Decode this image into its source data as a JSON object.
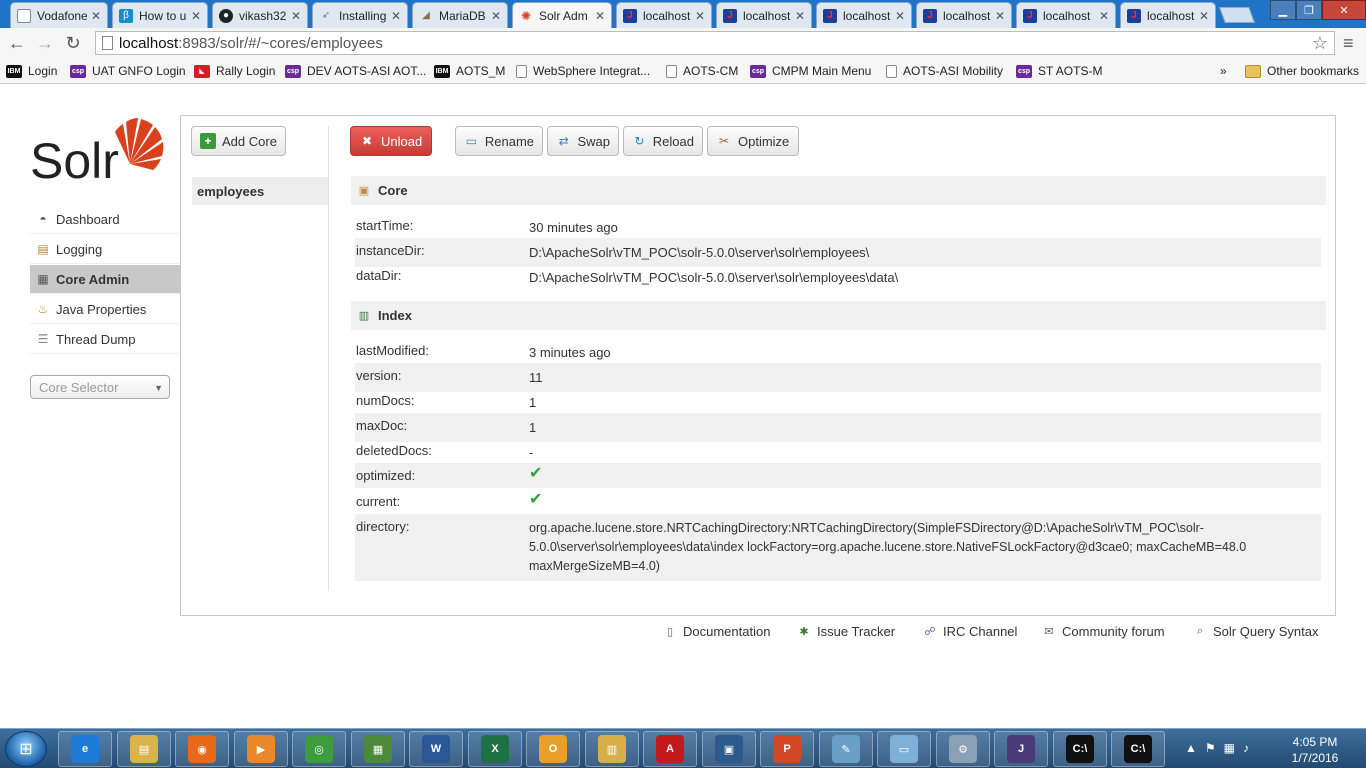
{
  "browser": {
    "tabs": [
      {
        "title": "Vodafone",
        "icon": "page-icon",
        "active": false
      },
      {
        "title": "How to u",
        "icon": "b-icon",
        "active": false
      },
      {
        "title": "vikash32",
        "icon": "github-icon",
        "active": false
      },
      {
        "title": "Installing",
        "icon": "feather-icon",
        "active": false
      },
      {
        "title": "MariaDB",
        "icon": "seal-icon",
        "active": false
      },
      {
        "title": "Solr Adm",
        "icon": "solr-icon",
        "active": true
      },
      {
        "title": "localhost",
        "icon": "j-icon",
        "active": false
      },
      {
        "title": "localhost",
        "icon": "j-icon",
        "active": false
      },
      {
        "title": "localhost",
        "icon": "j-icon",
        "active": false
      },
      {
        "title": "localhost",
        "icon": "j-icon",
        "active": false
      },
      {
        "title": "localhost",
        "icon": "j-icon",
        "active": false
      },
      {
        "title": "localhost",
        "icon": "j-icon",
        "active": false
      }
    ],
    "url_host": "localhost",
    "url_rest": ":8983/solr/#/~cores/employees",
    "bookmarks": [
      {
        "label": "Login",
        "icon": "ibm-icon"
      },
      {
        "label": "UAT GNFO Login",
        "icon": "csp-icon"
      },
      {
        "label": "Rally Login",
        "icon": "rally-icon"
      },
      {
        "label": "DEV AOTS-ASI AOT...",
        "icon": "csp-icon"
      },
      {
        "label": "AOTS_M",
        "icon": "ibm-icon"
      },
      {
        "label": "WebSphere Integrat...",
        "icon": "page-icon"
      },
      {
        "label": "AOTS-CM",
        "icon": "page-icon"
      },
      {
        "label": "CMPM Main Menu",
        "icon": "csp-icon"
      },
      {
        "label": "AOTS-ASI Mobility",
        "icon": "page-icon"
      },
      {
        "label": "ST AOTS-M",
        "icon": "csp-icon"
      }
    ],
    "bookmarks_overflow": "»",
    "other_bookmarks": "Other bookmarks",
    "ibm_text": "IBM",
    "csp_text": "csp"
  },
  "solr": {
    "logo_text": "Solr",
    "nav": [
      {
        "label": "Dashboard",
        "icon": "dashboard-icon"
      },
      {
        "label": "Logging",
        "icon": "logging-icon"
      },
      {
        "label": "Core Admin",
        "icon": "core-admin-icon",
        "active": true
      },
      {
        "label": "Java Properties",
        "icon": "java-properties-icon"
      },
      {
        "label": "Thread Dump",
        "icon": "thread-dump-icon"
      }
    ],
    "core_selector_placeholder": "Core Selector",
    "add_core_label": "Add Core",
    "core_list": [
      "employees"
    ],
    "actions": {
      "unload": "Unload",
      "rename": "Rename",
      "swap": "Swap",
      "reload": "Reload",
      "optimize": "Optimize"
    },
    "core_section": {
      "title": "Core",
      "rows": [
        {
          "key": "startTime:",
          "value": "30 minutes ago"
        },
        {
          "key": "instanceDir:",
          "value": "D:\\ApacheSolr\\vTM_POC\\solr-5.0.0\\server\\solr\\employees\\"
        },
        {
          "key": "dataDir:",
          "value": "D:\\ApacheSolr\\vTM_POC\\solr-5.0.0\\server\\solr\\employees\\data\\"
        }
      ]
    },
    "index_section": {
      "title": "Index",
      "rows": [
        {
          "key": "lastModified:",
          "value": "3 minutes ago"
        },
        {
          "key": "version:",
          "value": "11"
        },
        {
          "key": "numDocs:",
          "value": "1"
        },
        {
          "key": "maxDoc:",
          "value": "1"
        },
        {
          "key": "deletedDocs:",
          "value": "-"
        },
        {
          "key": "optimized:",
          "value": "✔"
        },
        {
          "key": "current:",
          "value": "✔"
        },
        {
          "key": "directory:",
          "value": "org.apache.lucene.store.NRTCachingDirectory:NRTCachingDirectory(SimpleFSDirectory@D:\\ApacheSolr\\vTM_POC\\solr-5.0.0\\server\\solr\\employees\\data\\index lockFactory=org.apache.lucene.store.NativeFSLockFactory@d3cae0; maxCacheMB=48.0 maxMergeSizeMB=4.0)"
        }
      ]
    },
    "footer": [
      {
        "label": "Documentation",
        "icon": "documentation-icon"
      },
      {
        "label": "Issue Tracker",
        "icon": "bug-icon"
      },
      {
        "label": "IRC Channel",
        "icon": "irc-icon"
      },
      {
        "label": "Community forum",
        "icon": "mail-icon"
      },
      {
        "label": "Solr Query Syntax",
        "icon": "query-syntax-icon"
      }
    ]
  },
  "taskbar": {
    "time": "4:05 PM",
    "date": "1/7/2016",
    "apps": [
      {
        "name": "internet-explorer-icon",
        "color": "#1e7ad6",
        "glyph": "e"
      },
      {
        "name": "file-explorer-icon",
        "color": "#d9b44a",
        "glyph": "▤"
      },
      {
        "name": "firefox-icon",
        "color": "#e66a1a",
        "glyph": "◉"
      },
      {
        "name": "media-player-icon",
        "color": "#e8892a",
        "glyph": "▶"
      },
      {
        "name": "chrome-icon",
        "color": "#3e9b3e",
        "glyph": "◎"
      },
      {
        "name": "project-icon",
        "color": "#4b8a3b",
        "glyph": "▦"
      },
      {
        "name": "word-icon",
        "color": "#2b5797",
        "glyph": "W"
      },
      {
        "name": "excel-icon",
        "color": "#1e7145",
        "glyph": "X"
      },
      {
        "name": "outlook-icon",
        "color": "#e8a02a",
        "glyph": "O"
      },
      {
        "name": "folders-icon",
        "color": "#d8b04a",
        "glyph": "▥"
      },
      {
        "name": "acrobat-icon",
        "color": "#c21a1a",
        "glyph": "A"
      },
      {
        "name": "virtualbox-icon",
        "color": "#2c5a8c",
        "glyph": "▣"
      },
      {
        "name": "powerpoint-icon",
        "color": "#d24726",
        "glyph": "P"
      },
      {
        "name": "paint-icon",
        "color": "#6aa0c8",
        "glyph": "✎"
      },
      {
        "name": "notepad-icon",
        "color": "#7fb0d8",
        "glyph": "▭"
      },
      {
        "name": "settings-icon",
        "color": "#8aa0b4",
        "glyph": "⚙"
      },
      {
        "name": "java-ee-ide-icon",
        "color": "#4a3a7a",
        "glyph": "J"
      },
      {
        "name": "command-prompt-icon",
        "color": "#111111",
        "glyph": "C:\\"
      },
      {
        "name": "command-prompt-icon",
        "color": "#111111",
        "glyph": "C:\\"
      }
    ]
  },
  "colors": {
    "unload_red": "#d9534f",
    "solr_orange": "#d9411e",
    "taskbar_blue": "#2f5b88"
  }
}
